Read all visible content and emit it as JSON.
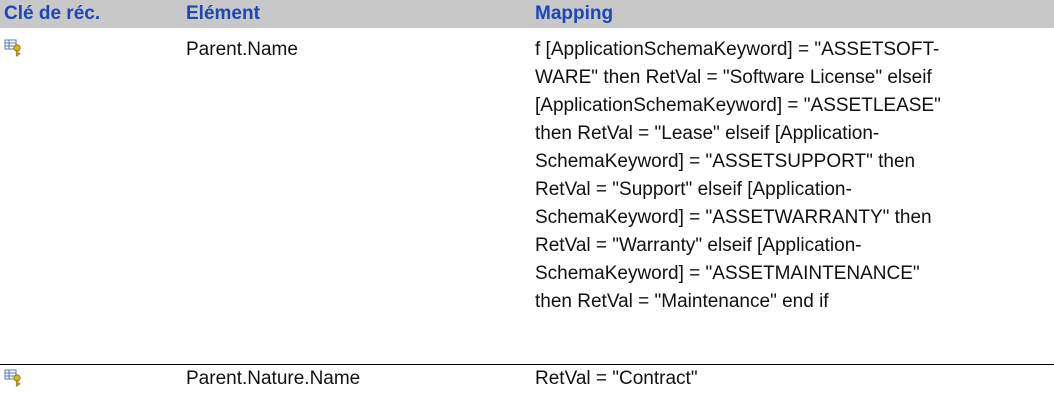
{
  "table": {
    "headers": {
      "key": "Clé de réc.",
      "element": "Elément",
      "mapping": "Mapping"
    },
    "rows": [
      {
        "key_icon": "key-field-icon",
        "element": "Parent.Name",
        "mapping_lines": [
          "f [ApplicationSchemaKeyword] = \"ASSETSOFT-",
          "WARE\" then RetVal = \"Software License\" elseif",
          "[ApplicationSchemaKeyword] = \"ASSETLEASE\"",
          "then RetVal = \"Lease\" elseif [Application-",
          "SchemaKeyword] = \"ASSETSUPPORT\" then",
          "RetVal = \"Support\" elseif [Application-",
          "SchemaKeyword] = \"ASSETWARRANTY\" then",
          "RetVal = \"Warranty\" elseif [Application-",
          "SchemaKeyword] = \"ASSETMAINTENANCE\"",
          "then RetVal = \"Maintenance\" end if"
        ]
      },
      {
        "key_icon": "key-field-icon",
        "element": "Parent.Nature.Name",
        "mapping_lines": [
          "RetVal = \"Contract\""
        ]
      }
    ]
  },
  "colors": {
    "header_background": "#c8c8c8",
    "header_text": "#1e46b4",
    "icon_key": "#d9b416",
    "icon_table": "#5a78b4"
  }
}
